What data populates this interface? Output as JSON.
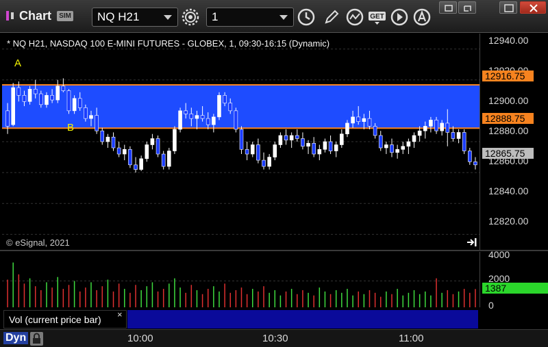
{
  "toolbar": {
    "title": "Chart",
    "badge": "SIM",
    "symbol": "NQ H21",
    "interval": "1",
    "buttons": [
      "settings-icon",
      "clock-icon",
      "pencil-icon",
      "studies-icon",
      "get-icon",
      "play-icon",
      "alert-icon"
    ],
    "window_buttons": [
      "restore-icon",
      "pop-out-icon",
      "maximize-icon",
      "close-icon"
    ]
  },
  "chart": {
    "title": "* NQ H21, NASDAQ 100 E-MINI FUTURES - GLOBEX, 1, 09:30-16:15 (Dynamic)",
    "copyright": "© eSignal, 2021",
    "marker_a": "A",
    "marker_b": "B",
    "band_color": "#1e4cff",
    "line_color": "#f7831f"
  },
  "price_axis": {
    "labels": [
      "12940.00",
      "12920.00",
      "12900.00",
      "12880.00",
      "12860.00",
      "12840.00",
      "12820.00"
    ],
    "tag_upper": "12916.75",
    "tag_lower": "12888.75",
    "tag_last": "12865.75"
  },
  "volume": {
    "axis_labels": [
      "4000",
      "2000",
      "0"
    ],
    "tag": "1387",
    "study_label": "Vol (current price bar)",
    "close_glyph": "×"
  },
  "time_axis": {
    "dyn_label": "Dyn",
    "labels": [
      "10:00",
      "10:30",
      "11:00"
    ]
  },
  "chart_data": {
    "type": "candlestick",
    "symbol": "NQ H21",
    "interval": "1",
    "ylim": [
      12810,
      12950
    ],
    "band": {
      "upper": 12916.75,
      "lower": 12888.75
    },
    "last": 12865.75,
    "x_ticks": [
      "10:00",
      "10:30",
      "11:00"
    ],
    "candles": [
      [
        12900,
        12905,
        12885,
        12890
      ],
      [
        12891,
        12918,
        12890,
        12915
      ],
      [
        12915,
        12919,
        12906,
        12910
      ],
      [
        12910,
        12913,
        12903,
        12906
      ],
      [
        12906,
        12916,
        12904,
        12914
      ],
      [
        12914,
        12920,
        12908,
        12911
      ],
      [
        12911,
        12913,
        12902,
        12904
      ],
      [
        12904,
        12912,
        12902,
        12910
      ],
      [
        12910,
        12914,
        12905,
        12907
      ],
      [
        12907,
        12920,
        12905,
        12916
      ],
      [
        12916,
        12921,
        12912,
        12913
      ],
      [
        12913,
        12914,
        12898,
        12900
      ],
      [
        12900,
        12910,
        12898,
        12908
      ],
      [
        12908,
        12912,
        12900,
        12902
      ],
      [
        12902,
        12904,
        12893,
        12895
      ],
      [
        12895,
        12900,
        12890,
        12897
      ],
      [
        12897,
        12902,
        12885,
        12887
      ],
      [
        12887,
        12889,
        12878,
        12880
      ],
      [
        12880,
        12885,
        12876,
        12883
      ],
      [
        12883,
        12886,
        12874,
        12876
      ],
      [
        12876,
        12880,
        12870,
        12872
      ],
      [
        12872,
        12878,
        12868,
        12875
      ],
      [
        12875,
        12877,
        12863,
        12865
      ],
      [
        12865,
        12870,
        12860,
        12862
      ],
      [
        12862,
        12871,
        12861,
        12869
      ],
      [
        12869,
        12880,
        12867,
        12878
      ],
      [
        12878,
        12885,
        12875,
        12882
      ],
      [
        12882,
        12884,
        12870,
        12872
      ],
      [
        12872,
        12874,
        12862,
        12864
      ],
      [
        12864,
        12876,
        12862,
        12874
      ],
      [
        12874,
        12890,
        12872,
        12888
      ],
      [
        12888,
        12902,
        12886,
        12900
      ],
      [
        12900,
        12905,
        12895,
        12898
      ],
      [
        12898,
        12902,
        12890,
        12895
      ],
      [
        12895,
        12900,
        12888,
        12897
      ],
      [
        12897,
        12903,
        12893,
        12895
      ],
      [
        12895,
        12899,
        12888,
        12891
      ],
      [
        12891,
        12898,
        12886,
        12896
      ],
      [
        12896,
        12912,
        12894,
        12910
      ],
      [
        12910,
        12912,
        12903,
        12905
      ],
      [
        12905,
        12908,
        12898,
        12900
      ],
      [
        12900,
        12902,
        12886,
        12888
      ],
      [
        12888,
        12890,
        12872,
        12875
      ],
      [
        12875,
        12880,
        12868,
        12872
      ],
      [
        12872,
        12880,
        12870,
        12878
      ],
      [
        12878,
        12882,
        12866,
        12868
      ],
      [
        12868,
        12873,
        12862,
        12864
      ],
      [
        12864,
        12872,
        12862,
        12870
      ],
      [
        12870,
        12880,
        12868,
        12878
      ],
      [
        12878,
        12886,
        12876,
        12884
      ],
      [
        12884,
        12888,
        12878,
        12881
      ],
      [
        12881,
        12886,
        12876,
        12884
      ],
      [
        12884,
        12888,
        12880,
        12882
      ],
      [
        12882,
        12886,
        12875,
        12877
      ],
      [
        12877,
        12881,
        12872,
        12879
      ],
      [
        12879,
        12883,
        12870,
        12872
      ],
      [
        12872,
        12878,
        12868,
        12875
      ],
      [
        12875,
        12882,
        12873,
        12880
      ],
      [
        12880,
        12884,
        12872,
        12874
      ],
      [
        12874,
        12880,
        12870,
        12878
      ],
      [
        12878,
        12888,
        12876,
        12885
      ],
      [
        12885,
        12894,
        12883,
        12892
      ],
      [
        12892,
        12900,
        12889,
        12896
      ],
      [
        12896,
        12903,
        12891,
        12893
      ],
      [
        12893,
        12898,
        12888,
        12895
      ],
      [
        12895,
        12900,
        12888,
        12890
      ],
      [
        12890,
        12892,
        12882,
        12884
      ],
      [
        12884,
        12887,
        12874,
        12876
      ],
      [
        12876,
        12880,
        12872,
        12878
      ],
      [
        12878,
        12882,
        12870,
        12873
      ],
      [
        12873,
        12878,
        12869,
        12875
      ],
      [
        12875,
        12880,
        12872,
        12877
      ],
      [
        12877,
        12882,
        12872,
        12880
      ],
      [
        12880,
        12886,
        12876,
        12884
      ],
      [
        12884,
        12890,
        12880,
        12887
      ],
      [
        12887,
        12893,
        12882,
        12890
      ],
      [
        12890,
        12896,
        12886,
        12894
      ],
      [
        12894,
        12896,
        12885,
        12887
      ],
      [
        12887,
        12894,
        12884,
        12892
      ],
      [
        12892,
        12901,
        12877,
        12886
      ],
      [
        12886,
        12890,
        12880,
        12882
      ],
      [
        12882,
        12888,
        12879,
        12886
      ],
      [
        12886,
        12888,
        12872,
        12874
      ],
      [
        12874,
        12876,
        12865,
        12867
      ],
      [
        12867,
        12870,
        12862,
        12865
      ]
    ],
    "volume": [
      2100,
      3400,
      2500,
      1800,
      2200,
      1600,
      1300,
      1900,
      1500,
      2300,
      1400,
      1700,
      2000,
      1200,
      1500,
      1900,
      1300,
      1600,
      2100,
      1200,
      1800,
      1400,
      1100,
      1700,
      1300,
      1600,
      1900,
      1200,
      1400,
      1800,
      2200,
      1500,
      1100,
      1700,
      1300,
      1000,
      1400,
      1600,
      1200,
      1800,
      1100,
      1300,
      1500,
      1000,
      1400,
      1200,
      1600,
      1100,
      1300,
      900,
      1200,
      1400,
      1000,
      1300,
      1100,
      900,
      1500,
      1200,
      1000,
      1300,
      1100,
      1400,
      900,
      1200,
      1000,
      1300,
      1100,
      800,
      1200,
      1000,
      1400,
      900,
      1100,
      1300,
      1000,
      1200,
      900,
      2200,
      1100,
      1300,
      1000,
      1200,
      1400,
      1100,
      1387
    ],
    "ylim_volume": [
      0,
      4000
    ]
  }
}
